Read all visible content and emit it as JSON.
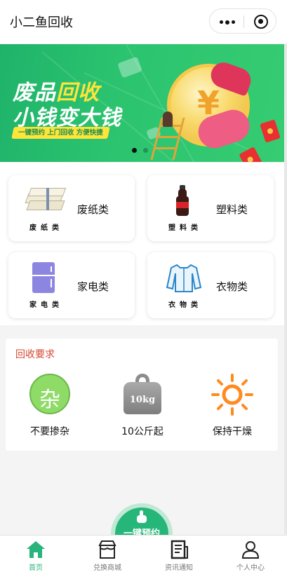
{
  "header": {
    "title": "小二鱼回收",
    "more_icon": "more-dots-icon",
    "close_icon": "target-close-icon"
  },
  "banner": {
    "line1_a": "废品",
    "line1_b": "回收",
    "line2": "小钱变大钱",
    "tagline": "一键预约 上门回收 方便快捷",
    "coin_symbol": "¥",
    "active_slide": 1,
    "slide_count": 2,
    "colors": {
      "bg": "#2bc36f",
      "accent": "#ffe43a"
    }
  },
  "categories": [
    {
      "name": "废纸类",
      "sub": "废纸类",
      "icon": "paper-stack-icon"
    },
    {
      "name": "塑料类",
      "sub": "塑料类",
      "icon": "cola-bottle-icon"
    },
    {
      "name": "家电类",
      "sub": "家电类",
      "icon": "fridge-icon"
    },
    {
      "name": "衣物类",
      "sub": "衣物类",
      "icon": "shirt-icon"
    }
  ],
  "requirements": {
    "title": "回收要求",
    "items": [
      {
        "label": "不要掺杂",
        "icon": "mixed-circle-icon",
        "glyph": "杂"
      },
      {
        "label": "10公斤起",
        "icon": "weight-icon",
        "glyph": "10kg"
      },
      {
        "label": "保持干燥",
        "icon": "sun-icon"
      }
    ]
  },
  "fab": {
    "label": "一键预约",
    "icon": "tap-hand-icon"
  },
  "tabbar": {
    "active": 0,
    "tabs": [
      {
        "label": "首页",
        "icon": "home-icon"
      },
      {
        "label": "兑换商城",
        "icon": "store-icon"
      },
      {
        "label": "资讯通知",
        "icon": "news-icon"
      },
      {
        "label": "个人中心",
        "icon": "user-icon"
      }
    ],
    "colors": {
      "active": "#28b47c",
      "inactive": "#777777"
    }
  }
}
